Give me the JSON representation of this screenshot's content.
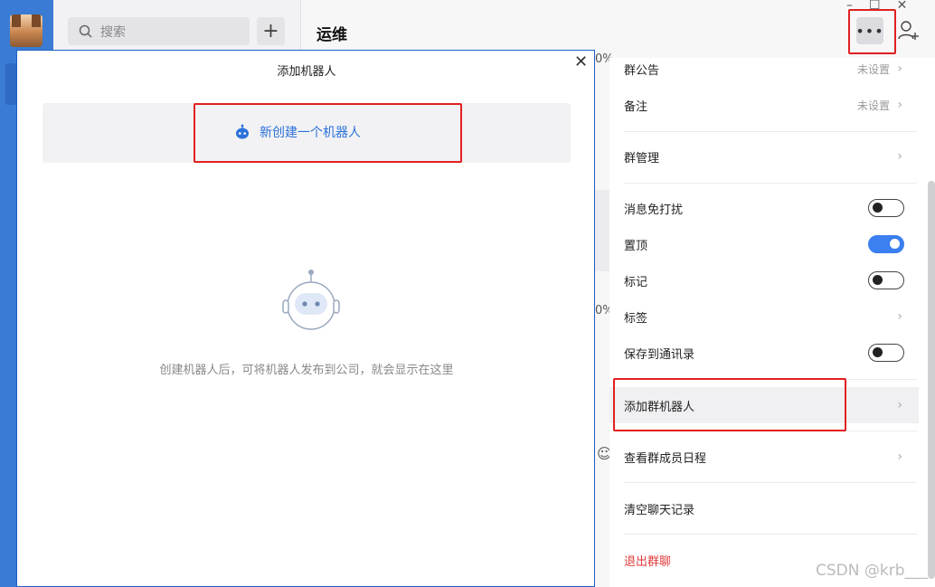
{
  "sidebar": {
    "avatar_alt": "user avatar"
  },
  "search": {
    "placeholder": "搜索"
  },
  "chat": {
    "title": "运维"
  },
  "background_fragments": {
    "percent1": "0%",
    "percent2": "0%"
  },
  "settings_panel": {
    "items": [
      {
        "label": "群公告",
        "value": "未设置",
        "type": "link"
      },
      {
        "label": "备注",
        "value": "未设置",
        "type": "link"
      },
      {
        "label": "群管理",
        "type": "link"
      },
      {
        "label": "消息免打扰",
        "type": "toggle",
        "on": false
      },
      {
        "label": "置顶",
        "type": "toggle",
        "on": true
      },
      {
        "label": "标记",
        "type": "toggle",
        "on": false
      },
      {
        "label": "标签",
        "type": "link"
      },
      {
        "label": "保存到通讯录",
        "type": "toggle",
        "on": false
      },
      {
        "label": "添加群机器人",
        "type": "link"
      },
      {
        "label": "查看群成员日程",
        "type": "link"
      },
      {
        "label": "清空聊天记录",
        "type": "action"
      },
      {
        "label": "退出群聊",
        "type": "danger"
      }
    ]
  },
  "modal": {
    "title": "添加机器人",
    "create_label": "新创建一个机器人",
    "empty_text": "创建机器人后，可将机器人发布到公司，就会显示在这里"
  },
  "colors": {
    "accent": "#3b7ff0",
    "danger": "#e03a3a",
    "highlight": "#e02020",
    "rail": "#3a7bd5"
  },
  "watermark": "CSDN @krb___"
}
